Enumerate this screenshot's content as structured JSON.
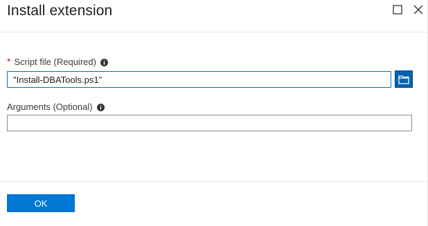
{
  "blade": {
    "title": "Install extension",
    "maximize_icon": "maximize-icon",
    "close_icon": "close-icon"
  },
  "form": {
    "script_file": {
      "required_marker": "*",
      "label": "Script file (Required)",
      "value": "\"Install-DBATools.ps1\"",
      "info_icon": "info-icon",
      "browse_icon": "folder-icon"
    },
    "arguments": {
      "label": "Arguments (Optional)",
      "value": "",
      "info_icon": "info-icon"
    }
  },
  "footer": {
    "ok_label": "OK"
  },
  "colors": {
    "accent": "#0078d4",
    "required": "#e00b1c",
    "border": "#8a8a8a"
  }
}
